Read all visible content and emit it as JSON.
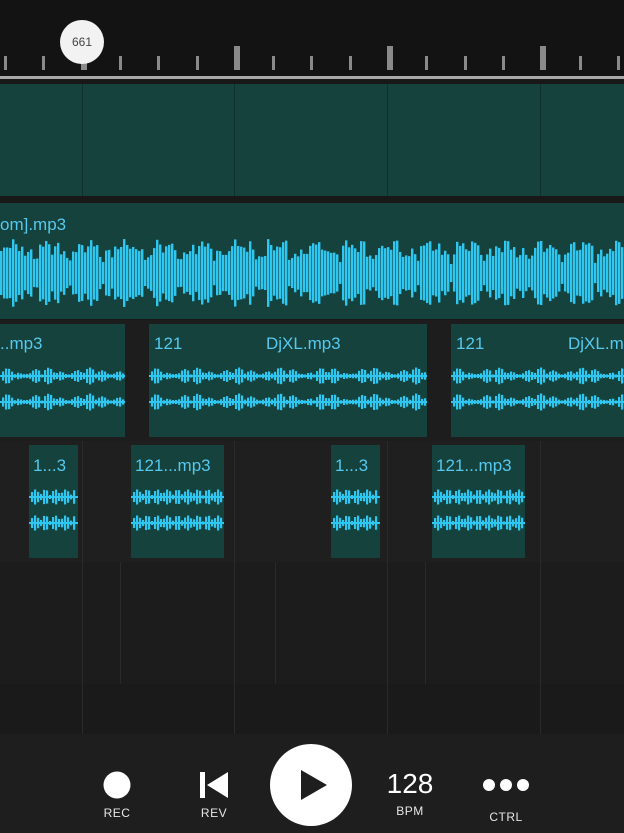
{
  "colors": {
    "clip_bg": "#15423c",
    "clip_bg_dark": "#1a3a36",
    "waveform": "#2ec7f2",
    "label": "#56c8ee",
    "background": "#1b1b1b",
    "ruler_bg": "#131313"
  },
  "ruler": {
    "playhead_label": "661"
  },
  "tracks": [
    {
      "clips": []
    },
    {
      "clips": [
        {
          "name": "om].mp3"
        }
      ]
    },
    {
      "clips": [
        {
          "name": "..mp3"
        },
        {
          "number": "121",
          "name": "DjXL.mp3"
        },
        {
          "number": "121",
          "name": "DjXL.mp"
        }
      ]
    },
    {
      "clips": [
        {
          "name": "1...3"
        },
        {
          "name": "121...mp3"
        },
        {
          "name": "1...3"
        },
        {
          "name": "121...mp3"
        }
      ]
    }
  ],
  "controls": {
    "rec": {
      "label": "REC",
      "icon": "record-icon"
    },
    "rev": {
      "label": "REV",
      "icon": "rewind-icon"
    },
    "play": {
      "icon": "play-icon"
    },
    "bpm": {
      "value": "128",
      "label": "BPM"
    },
    "ctrl": {
      "label": "CTRL",
      "icon": "more-icon"
    }
  }
}
